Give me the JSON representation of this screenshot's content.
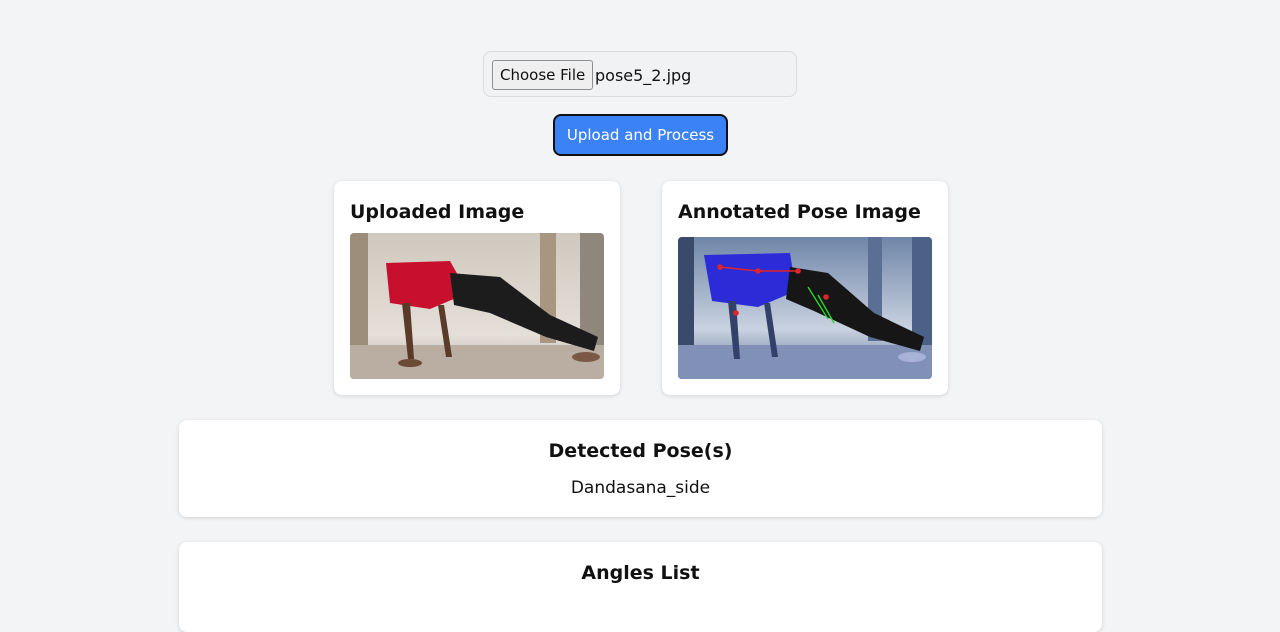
{
  "file_input": {
    "button_label": "Choose File",
    "file_name": "pose5_2.jpg"
  },
  "upload_button": {
    "label": "Upload and Process"
  },
  "uploaded": {
    "title": "Uploaded Image"
  },
  "annotated": {
    "title": "Annotated Pose Image"
  },
  "detected": {
    "title": "Detected Pose(s)",
    "value": "Dandasana_side"
  },
  "angles": {
    "title": "Angles List"
  },
  "colors": {
    "accent": "#3b82f6",
    "background": "#f3f4f6",
    "card": "#ffffff"
  }
}
